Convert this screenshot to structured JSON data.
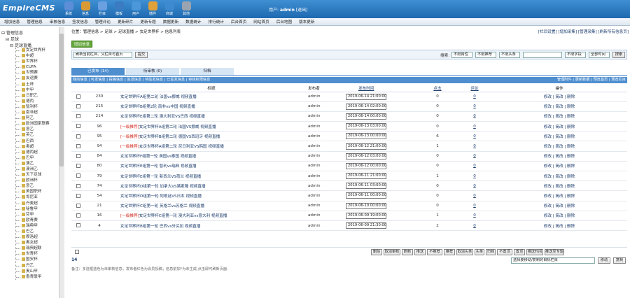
{
  "app": {
    "logo": "EmpireCMS",
    "user_label": "用户:",
    "user_name": "admin",
    "logout": "[退出]"
  },
  "top_icons": [
    {
      "label": "系统",
      "icon": "gear-icon",
      "color": "#5b8ed6"
    },
    {
      "label": "信息",
      "icon": "info-icon",
      "color": "#d99a35"
    },
    {
      "label": "栏目",
      "icon": "column-icon",
      "color": "#6aa0e0"
    },
    {
      "label": "模板",
      "icon": "template-icon",
      "color": "#3a7bc2"
    },
    {
      "label": "用户",
      "icon": "user-icon",
      "color": "#4c97d9"
    },
    {
      "label": "插件",
      "icon": "plugin-icon",
      "color": "#e0a13a"
    },
    {
      "label": "商城",
      "icon": "shop-icon",
      "color": "#3e8ad0"
    },
    {
      "label": "其他",
      "icon": "other-icon",
      "color": "#9aa4b0"
    }
  ],
  "menubar": [
    "增加信息",
    "管理信息",
    "审核信息",
    "签发信息",
    "管理评论",
    "更新碎片",
    "更新专题",
    "数据更新",
    "数据统计",
    "排行统计",
    "后台首页",
    "网站首页",
    "后台地图",
    "版本更新"
  ],
  "sidebar": {
    "root": "管理信息",
    "l1": "足球",
    "l2": "足球直播",
    "items": [
      "女足世界杯",
      "中超",
      "世界杯",
      "CUFA",
      "世预赛",
      "友谊赛",
      "土杯",
      "中甲",
      "日职乙",
      "德丙",
      "智利杯",
      "南非超",
      "阿乙",
      "欧洲国家联赛",
      "意乙",
      "英乙",
      "巴西",
      "奥超",
      "德丙超",
      "巴甲",
      "澳乙",
      "澳洲乙",
      "天下足球",
      "欧洲杯",
      "意乙",
      "美国职杯",
      "肯尼亚",
      "丹麦超",
      "秘鲁甲",
      "芬甲",
      "欧青赛",
      "瑞典甲",
      "巴乙",
      "摩洛超",
      "奥女超",
      "瑞典超联",
      "世青杯",
      "国安杯",
      "丹乙",
      "奥山甲",
      "香青联甲"
    ]
  },
  "main": {
    "crumb": "位置：管理信息 > 足球 > 足球直播 > 女足世界杯 > 信息列表",
    "right_links": "[栏目设置] [增加采集] [管理采集] [刷新所有信息页]",
    "add_btn": "增加信息",
    "filter": {
      "sel1": "刷新当前栏目、父栏目与首页",
      "btn1": "提交",
      "search_label": "搜索:",
      "s1": "不限属性",
      "s2": "不限推荐",
      "s3": "不限头条",
      "s4": "不限字段",
      "s5": "全部时间",
      "search_btn": "搜索"
    },
    "tabs": [
      {
        "label": "已发布 (14)",
        "active": true
      },
      {
        "label": "待审核 (0)",
        "active": false
      },
      {
        "label": "归档",
        "active": false
      }
    ],
    "sublinks": "我的信息 | 可发信息 | 投稿信息 | 签发信息 | 待签发信息 | 已签发信息 | 审核权限信息",
    "sublinks_right": "管理附件 | 更新数据 | 预览首页 | 预览栏目",
    "columns": {
      "title": "标题",
      "publisher": "发布者",
      "time": "发布时间",
      "clicks": "点击",
      "comments": "评论",
      "ops": "操作"
    },
    "rows": [
      {
        "id": "230",
        "prefix": "",
        "title": "女足世界杯A组第二轮 法国vs挪威 视频直播",
        "publisher": "admin",
        "time": "2019-06-14 21:00:00",
        "clicks": "0",
        "comments": "0"
      },
      {
        "id": "215",
        "prefix": "",
        "title": "女足世界杯B组第2轮 南非vs中国 视频直播",
        "publisher": "admin",
        "time": "2019-06-14 02:00:00",
        "clicks": "0",
        "comments": "0"
      },
      {
        "id": "214",
        "prefix": "",
        "title": "女足世界杯E组第二轮 澳大利亚VS巴西 视频直播",
        "publisher": "admin",
        "time": "2019-06-14 00:00:00",
        "clicks": "0",
        "comments": "0"
      },
      {
        "id": "96",
        "prefix": "[一级推荐]",
        "title": "女足世界杯A组第二轮 法国VS挪威 视频直播",
        "publisher": "admin",
        "time": "2019-06-13 03:00:00",
        "clicks": "0",
        "comments": "0"
      },
      {
        "id": "95",
        "prefix": "[一级推荐]",
        "title": "女足世界杯B组第二轮 德国VS西班牙 视频直播",
        "publisher": "admin",
        "time": "2019-06-13 00:00:00",
        "clicks": "6",
        "comments": "0"
      },
      {
        "id": "94",
        "prefix": "[一级推荐]",
        "title": "女足世界杯A组第二轮 尼日利亚VS韩国 视频直播",
        "publisher": "admin",
        "time": "2019-06-12 21:00:00",
        "clicks": "1",
        "comments": "0"
      },
      {
        "id": "84",
        "prefix": "",
        "title": "女足世界杯F组第一轮 美国vs泰国 视频直播",
        "publisher": "admin",
        "time": "2019-06-12 03:00:00",
        "clicks": "0",
        "comments": "0"
      },
      {
        "id": "80",
        "prefix": "",
        "title": "女足世界杯E组第一轮 智利vs瑞典 视频直播",
        "publisher": "admin",
        "time": "2019-06-12 00:00:00",
        "clicks": "0",
        "comments": "0"
      },
      {
        "id": "79",
        "prefix": "",
        "title": "女足世界杯E组第一轮 新西兰VS荷兰 视频直播",
        "publisher": "admin",
        "time": "2019-06-11 21:00:00",
        "clicks": "1",
        "comments": "0"
      },
      {
        "id": "74",
        "prefix": "",
        "title": "女足世界杯D组第一轮 加拿大VS喀麦隆 视频直播",
        "publisher": "admin",
        "time": "2019-06-11 03:00:00",
        "clicks": "0",
        "comments": "0"
      },
      {
        "id": "54",
        "prefix": "",
        "title": "女足世界杯D组第一轮 阿根廷VS日本 视频直播",
        "publisher": "admin",
        "time": "2019-06-11 00:00:00",
        "clicks": "0",
        "comments": "0"
      },
      {
        "id": "21",
        "prefix": "",
        "title": "女足世界杯C组第一轮 英格兰vs苏格兰 视频直播",
        "publisher": "admin",
        "time": "2019-06-10 00:00:00",
        "clicks": "0",
        "comments": "0"
      },
      {
        "id": "16",
        "prefix": "[一级推荐]",
        "title": "女足世界杯C组第一轮 澳大利亚vs意大利 视频直播",
        "publisher": "admin",
        "time": "2019-06-09 19:00:00",
        "clicks": "1",
        "comments": "0"
      },
      {
        "id": "4",
        "prefix": "",
        "title": "女足世界杯B组第一轮 巴西vs牙买加 视频直播",
        "publisher": "admin",
        "time": "2019-06-09 21:30:00",
        "clicks": "2",
        "comments": "0"
      }
    ],
    "row_ops": "修改 | 简改 | 删除",
    "bottom_buttons": [
      "删除",
      "取消审核",
      "刷新",
      "推送",
      "不推荐",
      "推荐",
      "取消头条",
      "头条",
      "归档",
      "不置顶",
      "置顶",
      "推送时间",
      "推送至专题"
    ],
    "count": "14",
    "move_select": "选择要移动/复制的目标栏目",
    "move_btn": "移动",
    "copy_btn": "复制",
    "note": "备注：多选框蓝色为未审核信息；发布者红色为会员投稿；信息前加*为未生成,点击即可刷新页面."
  }
}
